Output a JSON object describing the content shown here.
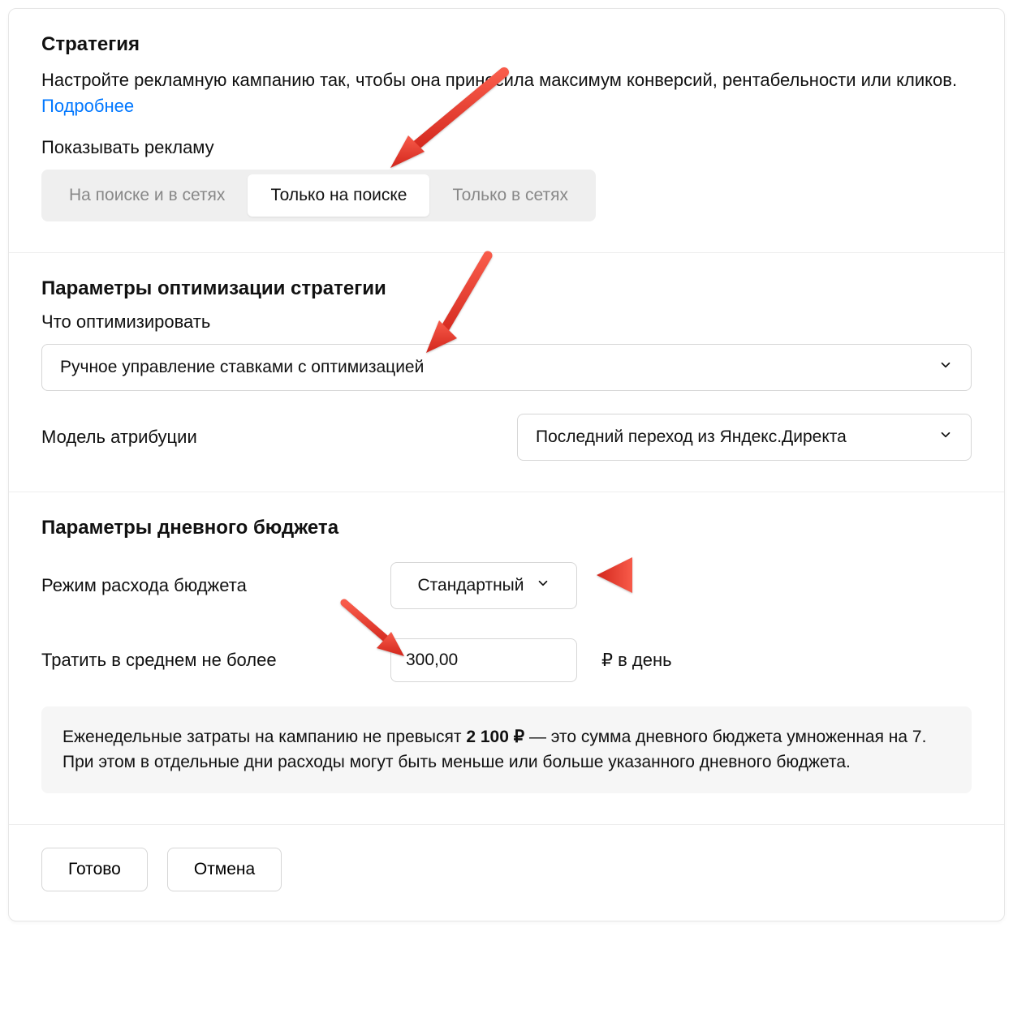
{
  "strategy": {
    "title": "Стратегия",
    "desc_before": "Настройте рекламную кампанию так, чтобы она приносила максимум конверсий, рентабельности или кликов. ",
    "desc_link": "Подробнее",
    "show_ads_label": "Показывать рекламу",
    "seg": {
      "opt1": "На поиске и в сетях",
      "opt2": "Только на поиске",
      "opt3": "Только в сетях"
    }
  },
  "optim": {
    "title": "Параметры оптимизации стратегии",
    "what_label": "Что оптимизировать",
    "what_value": "Ручное управление ставками с оптимизацией",
    "attr_label": "Модель атрибуции",
    "attr_value": "Последний переход из Яндекс.Директа"
  },
  "budget": {
    "title": "Параметры дневного бюджета",
    "mode_label": "Режим расхода бюджета",
    "mode_value": "Стандартный",
    "spend_label": "Тратить в среднем не более",
    "spend_value": "300,00",
    "spend_suffix": "₽ в день",
    "info_before": "Еженедельные затраты на кампанию не превысят ",
    "info_bold": "2 100 ₽",
    "info_after": " — это сумма дневного бюджета умноженная на 7. При этом в отдельные дни расходы могут быть меньше или больше указанного дневного бюджета."
  },
  "footer": {
    "done": "Готово",
    "cancel": "Отмена"
  },
  "colors": {
    "arrow": "#e43a2f"
  }
}
